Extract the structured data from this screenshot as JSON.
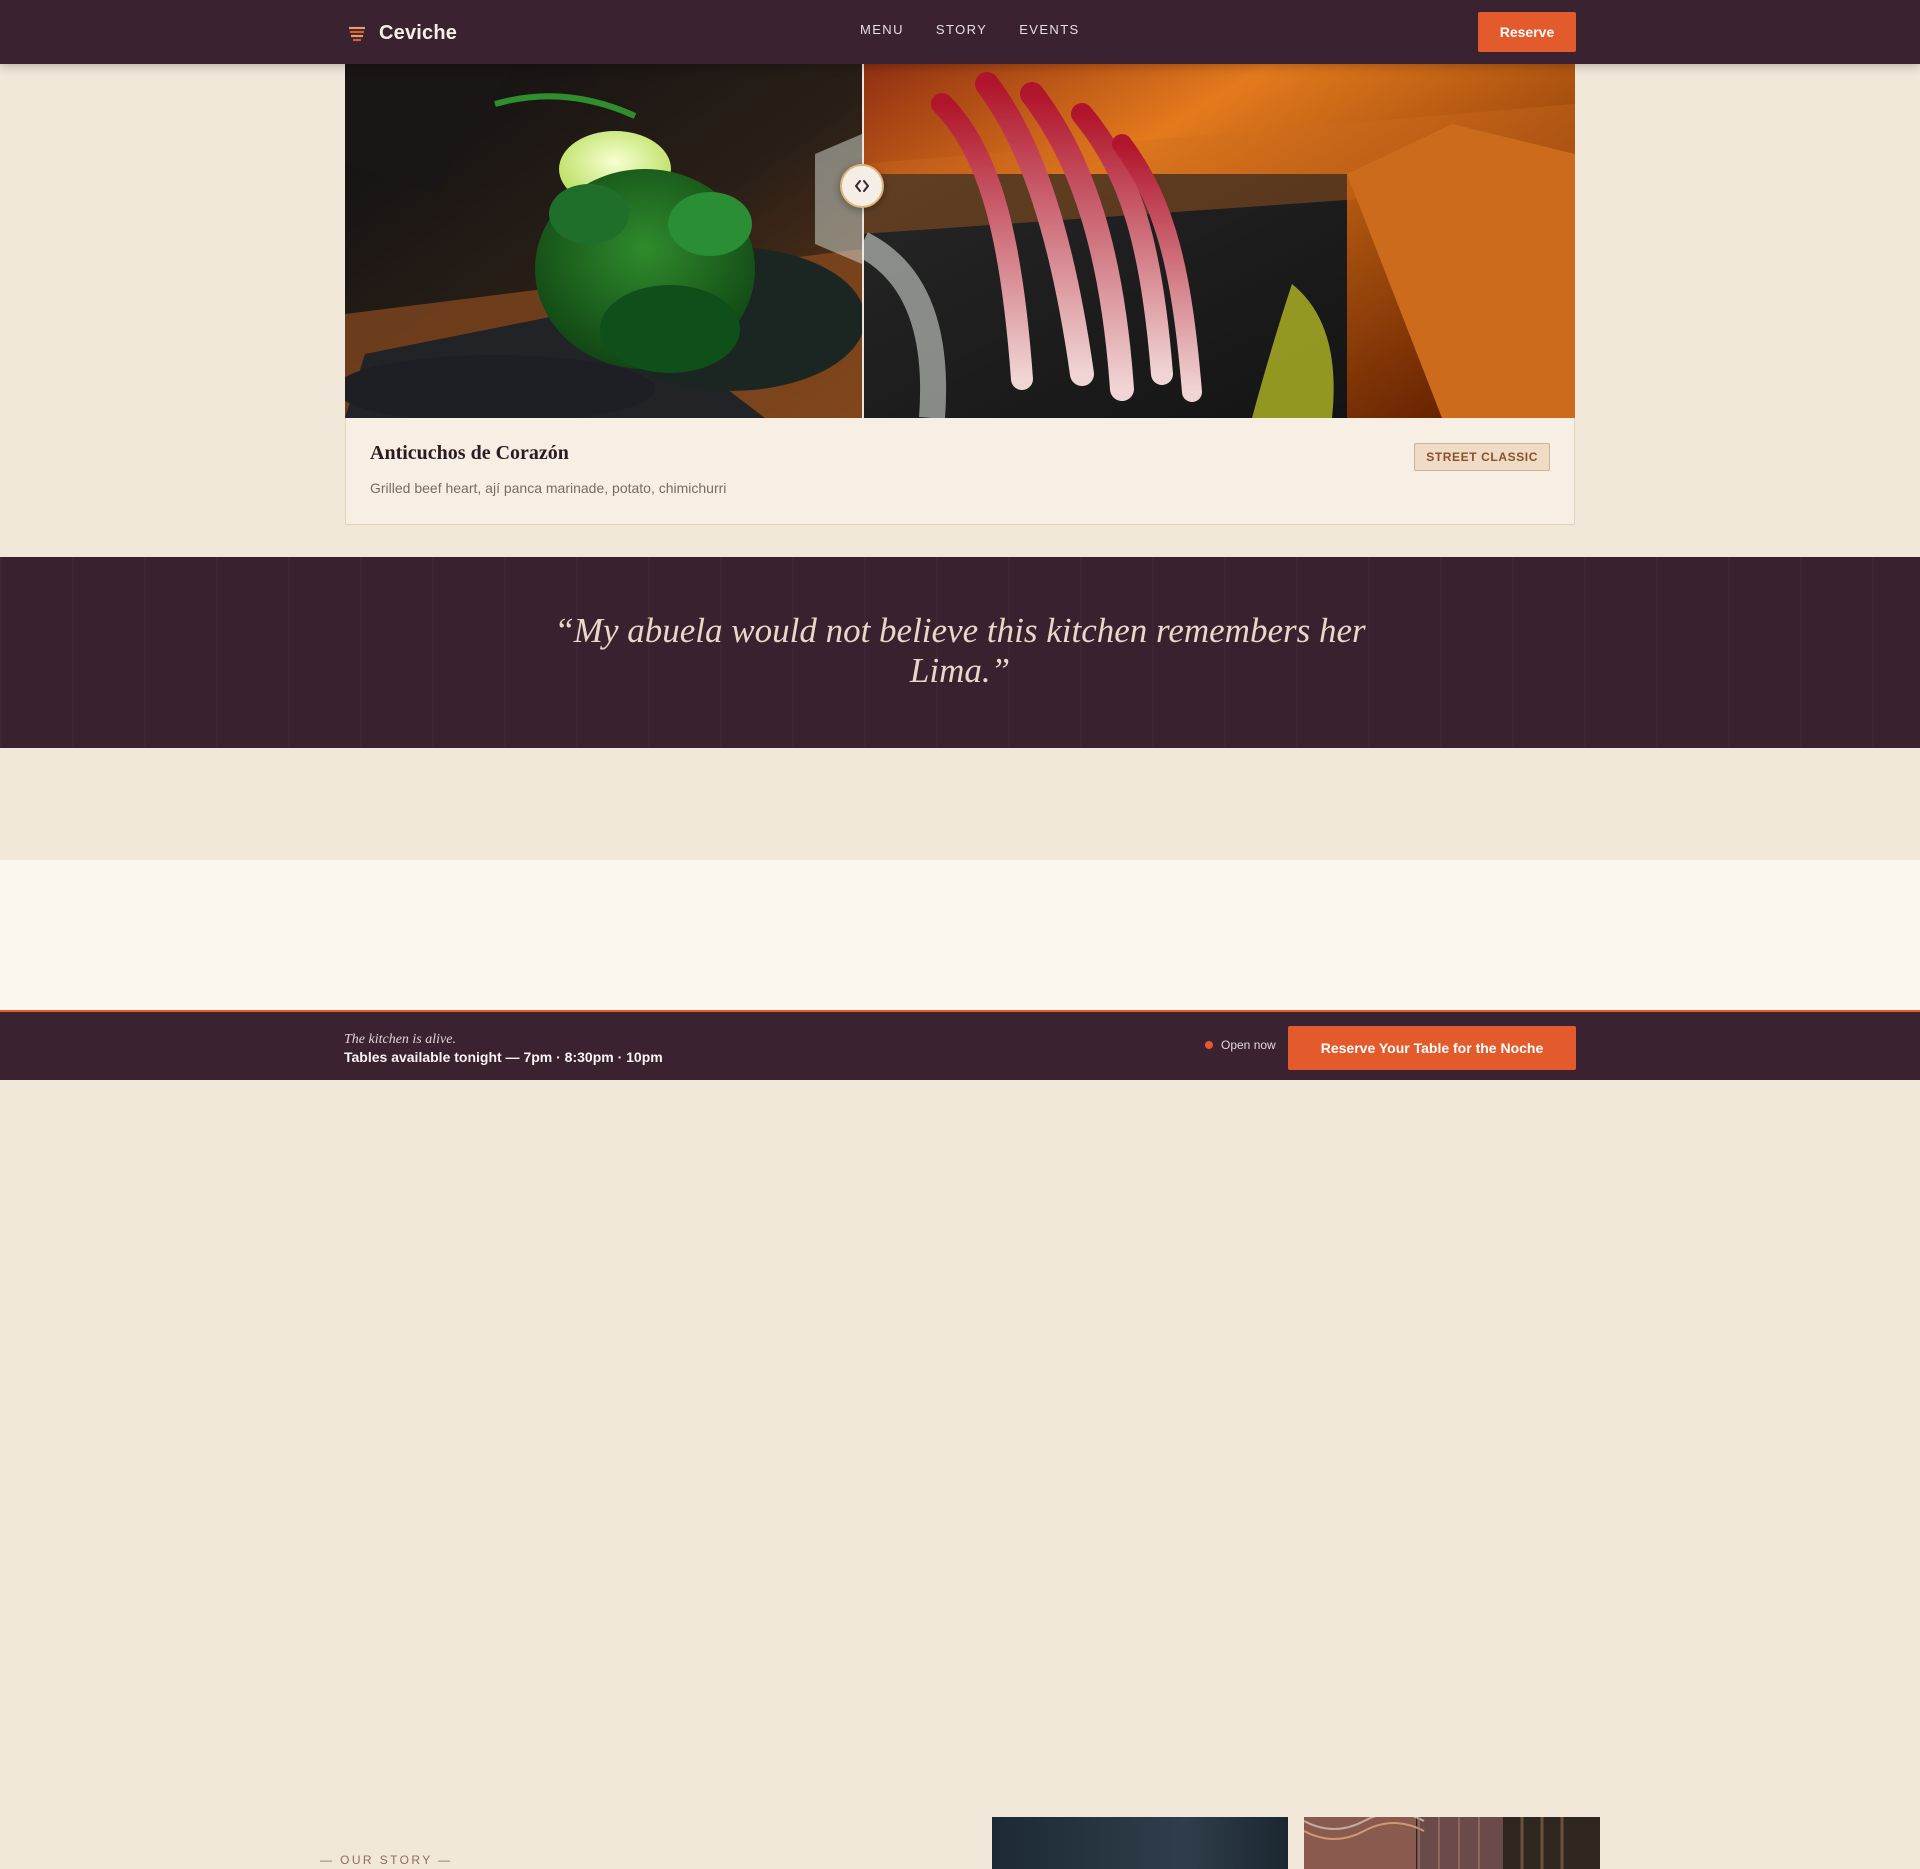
{
  "brand": {
    "name": "Ceviche",
    "logo": "ceviche-logo-icon"
  },
  "nav": {
    "links": [
      "MENU",
      "STORY",
      "EVENTS"
    ],
    "reserve_label": "Reserve"
  },
  "hero": {
    "compare_handle_icon": "chevrons-left-right-icon"
  },
  "dish": {
    "title": "Anticuchos de Corazón",
    "description": "Grilled beef heart, ají panca marinade, potato, chimichurri",
    "badge": "STREET CLASSIC"
  },
  "quote": {
    "text": "“My abuela would not believe this kitchen remembers her Lima.”"
  },
  "story": {
    "label": "— OUR STORY —"
  },
  "bottom_bar": {
    "tagline": "The kitchen is alive.",
    "availability": "Tables available tonight — 7pm · 8:30pm · 10pm",
    "status": "Open now",
    "cta": "Reserve Your Table for the Noche"
  },
  "colors": {
    "primary_dark": "#3a2230",
    "accent": "#e35a2d",
    "cream": "#f2e8d9",
    "card": "#f7efe4"
  }
}
